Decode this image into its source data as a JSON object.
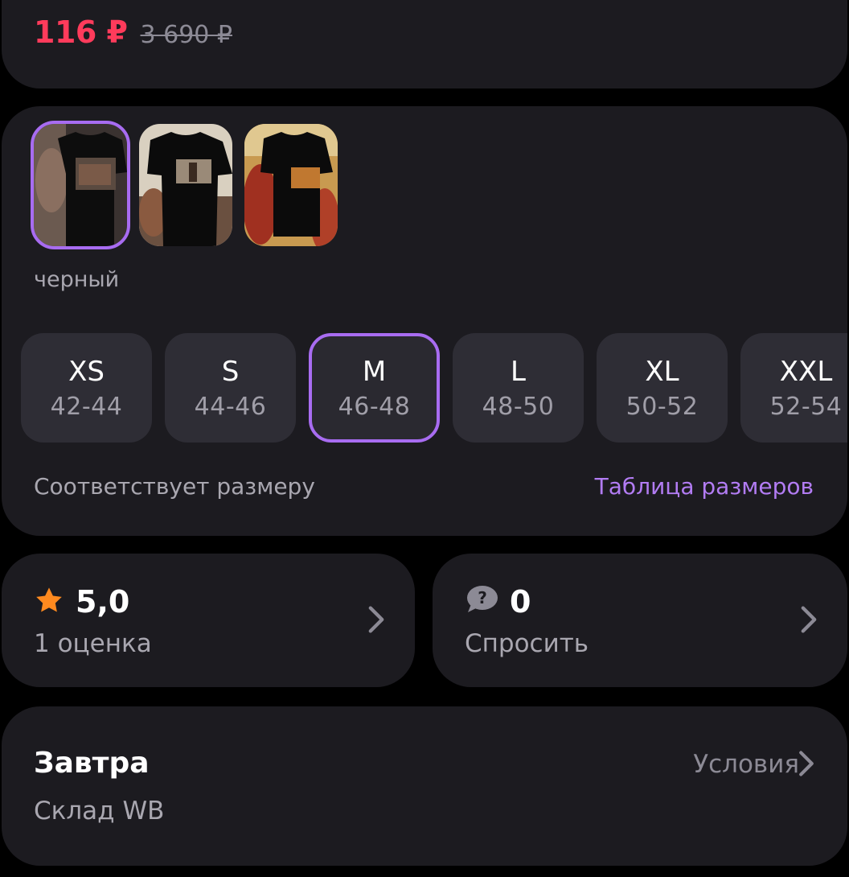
{
  "price": {
    "current": "116 ₽",
    "old": "3 690 ₽"
  },
  "variants": {
    "thumbnails": [
      {
        "name": "black-tshirt-front",
        "selected": true
      },
      {
        "name": "black-tshirt-spartan",
        "selected": false
      },
      {
        "name": "black-tshirt-spartan-red",
        "selected": false
      }
    ],
    "color_name": "черный"
  },
  "sizes": [
    {
      "label": "XS",
      "range": "42-44",
      "selected": false
    },
    {
      "label": "S",
      "range": "44-46",
      "selected": false
    },
    {
      "label": "M",
      "range": "46-48",
      "selected": true
    },
    {
      "label": "L",
      "range": "48-50",
      "selected": false
    },
    {
      "label": "XL",
      "range": "50-52",
      "selected": false
    },
    {
      "label": "XXL",
      "range": "52-54",
      "selected": false
    }
  ],
  "fit_text": "Соответствует размеру",
  "size_table_link": "Таблица размеров",
  "rating": {
    "value": "5,0",
    "count_text": "1 оценка",
    "icon": "star-icon"
  },
  "questions": {
    "value": "0",
    "action_text": "Спросить",
    "icon": "question-bubble-icon"
  },
  "delivery": {
    "title": "Завтра",
    "warehouse": "Склад WB",
    "conditions_label": "Условия"
  },
  "colors": {
    "accent": "#a86cf1",
    "price": "#ff3b5b",
    "card_bg": "#1c1b20",
    "star": "#ff8a1f"
  }
}
